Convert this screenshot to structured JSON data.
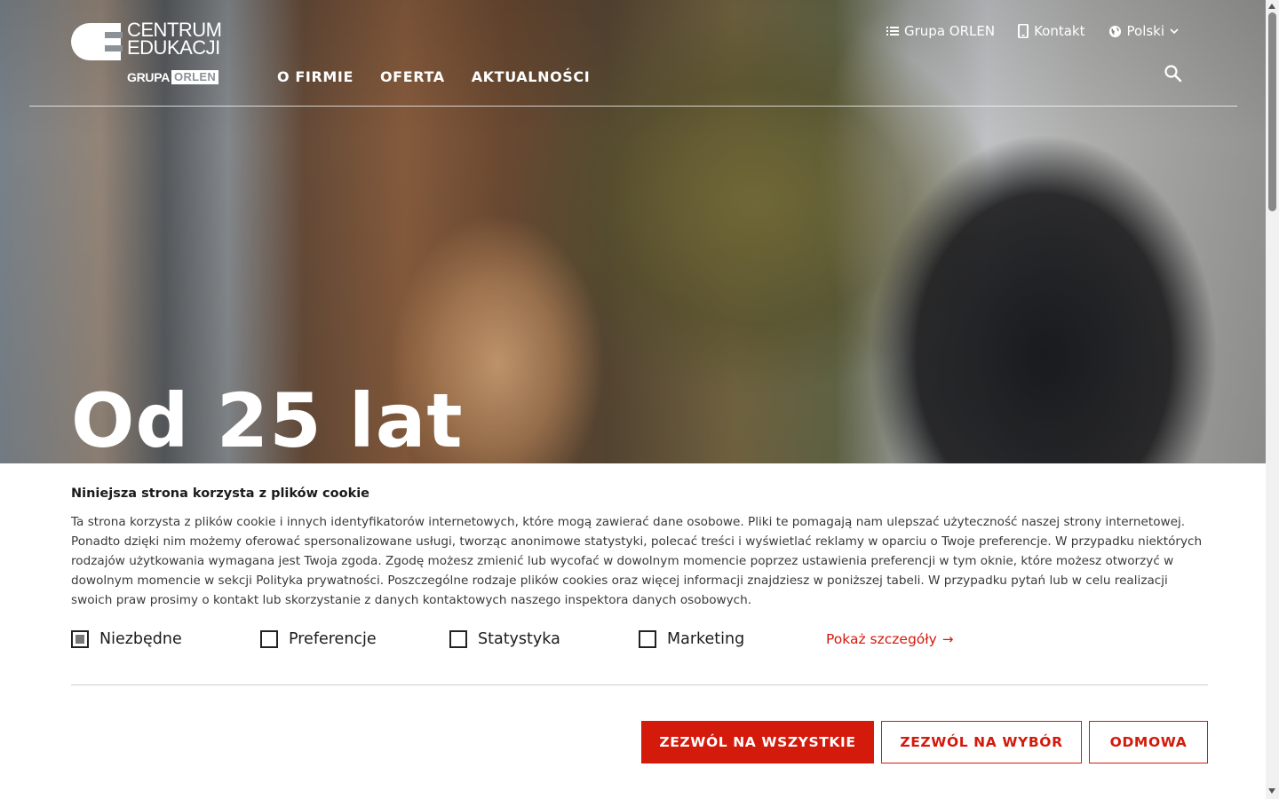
{
  "header": {
    "logo": {
      "line1": "CENTRUM",
      "line2": "EDUKACJI",
      "grupa": "GRUPA",
      "orlen": "ORLEN"
    },
    "nav": [
      "O FIRMIE",
      "OFERTA",
      "AKTUALNOŚCI"
    ],
    "top_links": {
      "group": "Grupa ORLEN",
      "contact": "Kontakt",
      "language": "Polski"
    },
    "icons": {
      "group": "list-icon",
      "contact": "phone-icon",
      "language": "globe-icon",
      "language_caret": "chevron-down-icon",
      "search": "search-icon"
    }
  },
  "hero": {
    "title": "Od 25 lat"
  },
  "cookie_banner": {
    "title": "Niniejsza strona korzysta z plików cookie",
    "text": "Ta strona korzysta z plików cookie i innych identyfikatorów internetowych, które mogą zawierać dane osobowe. Pliki te pomagają nam ulepszać użyteczność naszej strony internetowej. Ponadto dzięki nim możemy oferować spersonalizowane usługi, tworząc anonimowe statystyki, polecać treści i wyświetlać reklamy w oparciu o Twoje preferencje. W przypadku niektórych rodzajów użytkowania wymagana jest Twoja zgoda. Zgodę możesz zmienić lub wycofać w dowolnym momencie poprzez ustawienia preferencji w tym oknie, które możesz otworzyć w dowolnym momencie w sekcji Polityka prywatności. Poszczególne rodzaje plików cookies oraz więcej informacji znajdziesz w poniższej tabeli. W przypadku pytań lub w celu realizacji swoich praw prosimy o kontakt lub skorzystanie z danych kontaktowych naszego inspektora danych osobowych.",
    "checkboxes": [
      {
        "label": "Niezbędne",
        "checked": true,
        "disabled": true
      },
      {
        "label": "Preferencje",
        "checked": false
      },
      {
        "label": "Statystyka",
        "checked": false
      },
      {
        "label": "Marketing",
        "checked": false
      }
    ],
    "details_link": "Pokaż szczegóły",
    "buttons": {
      "allow_all": "ZEZWÓL NA WSZYSTKIE",
      "allow_selection": "ZEZWÓL NA WYBÓR",
      "deny": "ODMOWA"
    }
  },
  "colors": {
    "accent": "#d31a0b",
    "text": "#1b1b1b",
    "body_text": "#3a3a3a"
  }
}
